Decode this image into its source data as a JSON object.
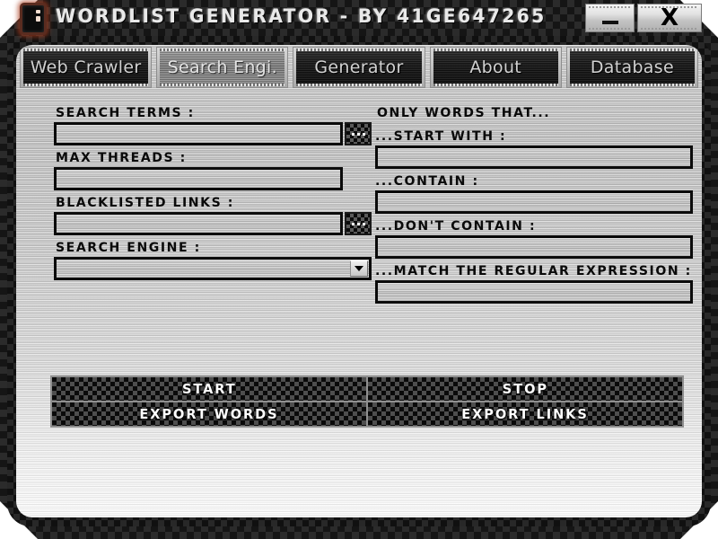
{
  "window": {
    "title": "WORDLIST GENERATOR - BY 41GE647265",
    "icon": "app-logo-icon",
    "minimize_label": "_",
    "close_label": "X"
  },
  "tabs": [
    {
      "label": "Web Crawler",
      "selected": false
    },
    {
      "label": "Search Engi.",
      "selected": true
    },
    {
      "label": "Generator",
      "selected": false
    },
    {
      "label": "About",
      "selected": false
    },
    {
      "label": "Database",
      "selected": false
    }
  ],
  "left_column": {
    "search_terms": {
      "label": "SEARCH TERMS :",
      "value": "",
      "placeholder": "",
      "browse_label": "..."
    },
    "max_threads": {
      "label": "MAX THREADS :",
      "value": "",
      "placeholder": ""
    },
    "blacklisted_links": {
      "label": "BLACKLISTED LINKS :",
      "value": "",
      "placeholder": "",
      "browse_label": "..."
    },
    "search_engine": {
      "label": "SEARCH ENGINE :",
      "selected_option": "",
      "options": []
    }
  },
  "right_column": {
    "heading": "ONLY WORDS THAT...",
    "start_with": {
      "label": "...START WITH :",
      "value": "",
      "placeholder": ""
    },
    "contain": {
      "label": "...CONTAIN :",
      "value": "",
      "placeholder": ""
    },
    "dont_contain": {
      "label": "...DON'T CONTAIN :",
      "value": "",
      "placeholder": ""
    },
    "regex": {
      "label": "...MATCH THE REGULAR EXPRESSION :",
      "value": "",
      "placeholder": ""
    }
  },
  "actions": [
    {
      "label": "START"
    },
    {
      "label": "STOP"
    },
    {
      "label": "EXPORT WORDS"
    },
    {
      "label": "EXPORT LINKS"
    }
  ],
  "colors": {
    "frame_dark": "#101010",
    "panel_metal": "#c7c7c7",
    "tab_face": "#151515",
    "tab_selected": "#6e6e6e",
    "text_light": "#d2d2d2",
    "text_dark": "#0a0a0a",
    "icon_glow": "#aa3c1e"
  }
}
